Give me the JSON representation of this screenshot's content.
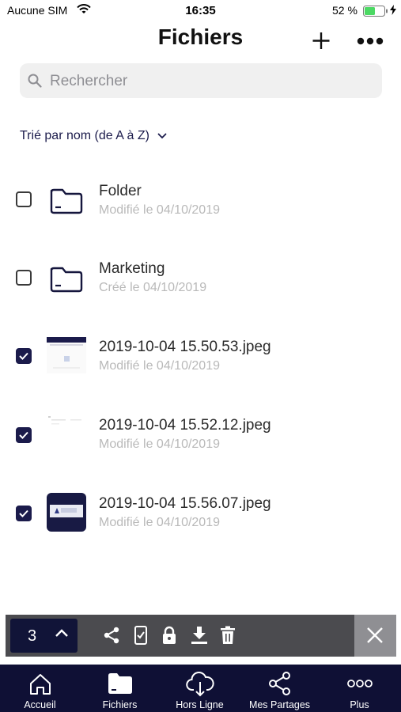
{
  "status_bar": {
    "carrier": "Aucune SIM",
    "time": "16:35",
    "battery": "52 %"
  },
  "header": {
    "title": "Fichiers",
    "add_icon": "plus-icon",
    "more_icon": "ellipsis-icon"
  },
  "search": {
    "placeholder": "Rechercher"
  },
  "sort": {
    "label": "Trié par nom (de A à Z)"
  },
  "files": [
    {
      "name": "Folder",
      "meta": "Modifié le 04/10/2019",
      "type": "folder",
      "checked": false
    },
    {
      "name": "Marketing",
      "meta": "Créé le 04/10/2019",
      "type": "folder",
      "checked": false
    },
    {
      "name": "2019-10-04 15.50.53.jpeg",
      "meta": "Modifié le 04/10/2019",
      "type": "image",
      "checked": true
    },
    {
      "name": "2019-10-04 15.52.12.jpeg",
      "meta": "Modifié le 04/10/2019",
      "type": "image",
      "checked": true
    },
    {
      "name": "2019-10-04 15.56.07.jpeg",
      "meta": "Modifié le 04/10/2019",
      "type": "image",
      "checked": true
    }
  ],
  "action_bar": {
    "selected_count": "3",
    "actions": [
      "share-icon",
      "phone-check-icon",
      "lock-icon",
      "download-icon",
      "trash-icon"
    ]
  },
  "tabs": [
    {
      "label": "Accueil",
      "icon": "home-icon"
    },
    {
      "label": "Fichiers",
      "icon": "folder-icon"
    },
    {
      "label": "Hors Ligne",
      "icon": "cloud-download-icon"
    },
    {
      "label": "Mes Partages",
      "icon": "share-icon"
    },
    {
      "label": "Plus",
      "icon": "more-icon"
    }
  ],
  "colors": {
    "navy": "#0f1035",
    "accent": "#1b1b4b",
    "action_bar": "#4b4b4f",
    "battery": "#4cd964"
  }
}
